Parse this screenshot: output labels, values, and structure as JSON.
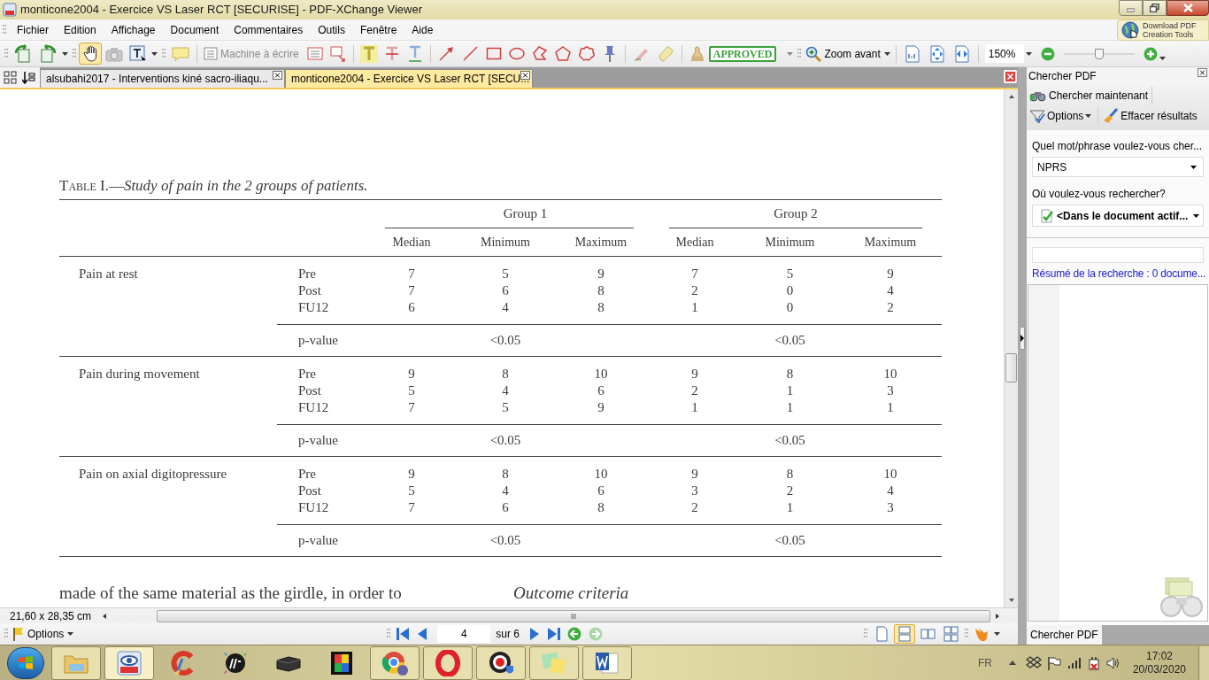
{
  "window": {
    "title": "monticone2004 - Exercice VS Laser RCT [SECURISE] - PDF-XChange Viewer"
  },
  "menu": [
    "Fichier",
    "Edition",
    "Affichage",
    "Document",
    "Commentaires",
    "Outils",
    "Fenêtre",
    "Aide"
  ],
  "promo_button": {
    "lines": [
      "Download PDF",
      "Creation Tools"
    ]
  },
  "toolbar": {
    "hand_tool_selected": true,
    "typewriter": "Machine à écrire",
    "stamp": "APPROVED",
    "zoom_button": "Zoom avant",
    "zoom_value": "150%",
    "zoom_slider": {
      "level": 0.5
    }
  },
  "tabs": [
    {
      "label": "alsubahi2017 - Interventions kiné sacro-iliaqu...",
      "selected": false
    },
    {
      "label": "monticone2004 - Exercice VS Laser RCT [SECU...",
      "selected": true
    }
  ],
  "document": {
    "caption_label": "Table I.—",
    "caption_title": "Study of pain in the 2 groups of patients.",
    "groups": [
      "Group 1",
      "Group 2"
    ],
    "columns": [
      "Median",
      "Minimum",
      "Maximum",
      "Median",
      "Minimum",
      "Maximum"
    ],
    "sections": [
      {
        "label": "Pain at rest",
        "rows": [
          {
            "phase": "Pre",
            "values": [
              "7",
              "5",
              "9",
              "7",
              "5",
              "9"
            ]
          },
          {
            "phase": "Post",
            "values": [
              "7",
              "6",
              "8",
              "2",
              "0",
              "4"
            ]
          },
          {
            "phase": "FU12",
            "values": [
              "6",
              "4",
              "8",
              "1",
              "0",
              "2"
            ]
          }
        ],
        "pvalue_label": "p-value",
        "pvalues": [
          "<0.05",
          "<0.05"
        ]
      },
      {
        "label": "Pain during movement",
        "rows": [
          {
            "phase": "Pre",
            "values": [
              "9",
              "8",
              "10",
              "9",
              "8",
              "10"
            ]
          },
          {
            "phase": "Post",
            "values": [
              "5",
              "4",
              "6",
              "2",
              "1",
              "3"
            ]
          },
          {
            "phase": "FU12",
            "values": [
              "7",
              "5",
              "9",
              "1",
              "1",
              "1"
            ]
          }
        ],
        "pvalue_label": "p-value",
        "pvalues": [
          "<0.05",
          "<0.05"
        ]
      },
      {
        "label": "Pain on axial digitopressure",
        "rows": [
          {
            "phase": "Pre",
            "values": [
              "9",
              "8",
              "10",
              "9",
              "8",
              "10"
            ]
          },
          {
            "phase": "Post",
            "values": [
              "5",
              "4",
              "6",
              "3",
              "2",
              "4"
            ]
          },
          {
            "phase": "FU12",
            "values": [
              "7",
              "6",
              "8",
              "2",
              "1",
              "3"
            ]
          }
        ],
        "pvalue_label": "p-value",
        "pvalues": [
          "<0.05",
          "<0.05"
        ]
      }
    ],
    "body_text": [
      "made of the same material as the girdle, in order to",
      "Outcome criteria"
    ]
  },
  "search_panel": {
    "title": "Chercher PDF",
    "search_button": "Chercher maintenant",
    "options_button": "Options",
    "clear_button": "Effacer résultats",
    "query_label": "Quel mot/phrase voulez-vous cher...",
    "query": "NPRS",
    "scope_label": "Où voulez-vous rechercher?",
    "scope": "<Dans le document actif...",
    "summary": "Résumé de la recherche : 0 docume...",
    "tab": "Chercher PDF"
  },
  "status": {
    "page_size": "21,60 x 28,35 cm"
  },
  "navigation": {
    "options": "Options",
    "page": "4",
    "page_count": "sur 6",
    "layout_modes": [
      {
        "kind": "single",
        "selected": false
      },
      {
        "kind": "continuous",
        "selected": true
      },
      {
        "kind": "facing",
        "selected": false
      },
      {
        "kind": "facing_continuous",
        "selected": false
      }
    ]
  },
  "taskbar": {
    "language": "FR",
    "time": "17:02",
    "date": "20/03/2020"
  }
}
